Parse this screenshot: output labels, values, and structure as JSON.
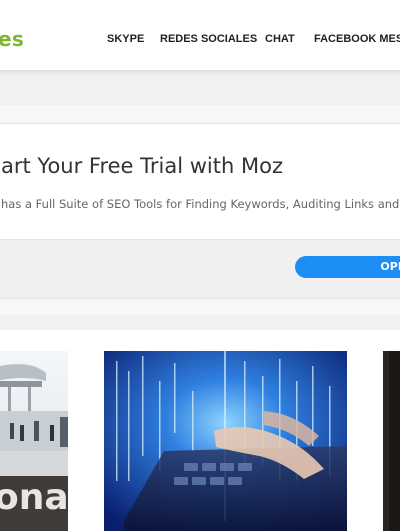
{
  "header": {
    "logo_text": "es",
    "logo_color": "#7cb82f",
    "nav": [
      {
        "label": "SKYPE"
      },
      {
        "label": "REDES SOCIALES"
      },
      {
        "label": "CHAT"
      },
      {
        "label": "FACEBOOK MESS"
      }
    ]
  },
  "promo": {
    "title": "art Your Free Trial with Moz",
    "subtitle": "has a Full Suite of SEO Tools for Finding Keywords, Auditing Links and Fi",
    "button_label": "OPEN",
    "button_color": "#1d8ef5"
  },
  "articles": [
    {
      "image": "conference-building-photo",
      "overlay_text": "ona"
    },
    {
      "image": "laptop-binary-code-photo"
    },
    {
      "image": "dark-photo"
    }
  ]
}
